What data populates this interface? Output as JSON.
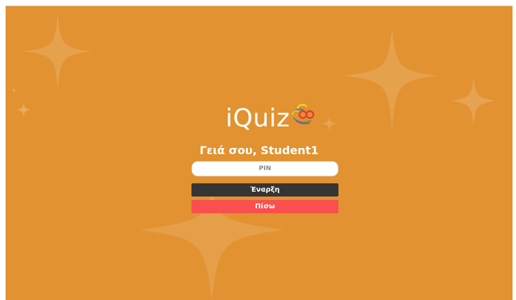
{
  "app": {
    "logo_text": "iQuiz",
    "logo_icon": "glasses-icon"
  },
  "login": {
    "greeting": "Γειά σου, Student1",
    "pin_placeholder": "PIN",
    "pin_value": "",
    "start_label": "Έναρξη",
    "back_label": "Πίσω"
  },
  "colors": {
    "background": "#e29230",
    "start_button": "#353535",
    "back_button": "#fa4f4f",
    "text": "#ffffff"
  }
}
